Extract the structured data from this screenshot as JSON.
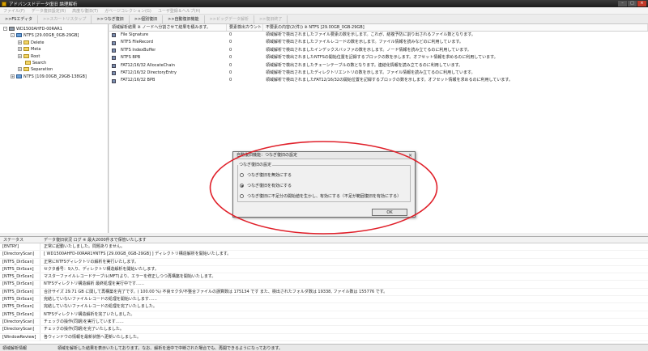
{
  "window": {
    "title": "アドバンスドデータ復旧 論理解析"
  },
  "menu": [
    "ファイル(F)",
    "データ復旧設定(R)",
    "高度な復旧(T)",
    "ガベージコレクション(G)",
    "ユーザ登録＆ヘルプ(H)"
  ],
  "toolbar": [
    {
      "label": ">>FSエディタ",
      "enabled": true
    },
    {
      "label": ">>スカートリスタップ",
      "enabled": false
    },
    {
      "label": ">>つなぎ復旧",
      "enabled": true
    },
    {
      "label": ">>個別復旧",
      "enabled": true
    },
    {
      "label": ">>自動復旧機能",
      "enabled": true
    },
    {
      "label": ">>ビッグデータ解析",
      "enabled": false
    },
    {
      "label": ">>復旧終了",
      "enabled": false
    }
  ],
  "tree": [
    {
      "label": "WD1500AHFD-00RAR1",
      "depth": 0,
      "icon": "disk-icon",
      "expander": "-"
    },
    {
      "label": "NTFS [29.00GB_0GB-29GB]",
      "depth": 1,
      "icon": "volume-icon",
      "expander": "-"
    },
    {
      "label": "Delete",
      "depth": 2,
      "icon": "folder-icon",
      "expander": "+"
    },
    {
      "label": "Meta",
      "depth": 2,
      "icon": "folder-icon",
      "expander": "+"
    },
    {
      "label": "Root",
      "depth": 2,
      "icon": "folder-icon",
      "expander": "+"
    },
    {
      "label": "Search",
      "depth": 2,
      "icon": "folder-icon",
      "expander": ""
    },
    {
      "label": "Separation",
      "depth": 2,
      "icon": "folder-icon",
      "expander": "+"
    },
    {
      "label": "NTFS [109.00GB_29GB-138GB]",
      "depth": 1,
      "icon": "volume-icon",
      "expander": "+"
    }
  ],
  "list": {
    "headers": [
      "領域解析結果 ※ ノードへ分割させて結果を積みます。",
      "要素検出カウント",
      "不要素の内容(2(件)) ※ NTFS [29.00GB_0GB-29GB]"
    ],
    "rows": [
      [
        "File Signature",
        "0",
        "領域解析で検出されましたファイル要素の数を示します。これが、結複予防に割り出されるファイル数となります。"
      ],
      [
        "NTFS FileRecord",
        "0",
        "領域解析で検出されましたファイルレコードの数を示します。ファイル情報を読みなどのに利用しています。"
      ],
      [
        "NTFS IndexBuffer",
        "0",
        "領域解析で検出されましたインデックスバッファの数を示します。ノード情報を読み立てるのに利用しています。"
      ],
      [
        "NTFS BPB",
        "0",
        "領域解析で検出されましたNTFSの開始位置を記録するブロックの数を示します。オフセット情報を求めるのに利用しています。"
      ],
      [
        "FAT12/16/32 AllocateChain",
        "0",
        "領域解析で検出されましたチェーンテーブルの数となります。連結化情報を読み立てるのに利用しています。"
      ],
      [
        "FAT12/16/32 DirectoryEntry",
        "0",
        "領域解析で検出されましたディレクトリエントリの数を示します。ファイル情報を読み立てるのに利用しています。"
      ],
      [
        "FAT12/16/32 BPB",
        "0",
        "領域解析で検出されましたFAT12/16/32の開始位置を記録するブロックの数を示します。オフセット情報を求めるのに利用しています。"
      ]
    ]
  },
  "dialog": {
    "title": "自動復旧機能：つなぎ復旧の設定",
    "close": "×",
    "group_label": "つなぎ復旧の設定",
    "options": [
      {
        "label": "つなぎ復旧を無効にする",
        "selected": false
      },
      {
        "label": "つなぎ復旧を有効にする",
        "selected": true
      },
      {
        "label": "つなぎ復旧に不足分の開始値を生かし、有効にする（不足が範囲復旧を有効にする）",
        "selected": false
      }
    ],
    "ok": "OK"
  },
  "log": {
    "header": [
      "ステータス",
      "データ復旧状況 ログ ※ 最大2000件まで保管いたします"
    ],
    "rows": [
      [
        "[ENTRY]",
        "正常に起動いたしました。問題ありません。"
      ],
      [
        "[DirectoryScan]",
        "[ WD1500AHFD-00RAR1¥NTFS [29.00GB_0GB-29GB] ] ディレクトリ構造解析を開始いたします。"
      ],
      [
        "[NTFS_DirScan]",
        "正常にNTFSディレクトリの解析を実行いたします。"
      ],
      [
        "[NTFS_DirScan]",
        "セクタ番号：9入り、ディレクトリ構造解析を開始いたします。"
      ],
      [
        "[NTFS_DirScan]",
        "マスターファイルレコードテーブル(MFT)より、エラーを修正しつつ再構築を開始いたします。"
      ],
      [
        "[NTFS_DirScan]",
        "NTFSディレクトリ構造解析 最終処理を実行中です……"
      ],
      [
        "[NTFS_DirScan]",
        "合計サイズ 29.71 GB に関して再構築を完了です。( 100.00 %) 不良セクタ/不整合ファイルの誤算数は 175134 です また、検出されたフォルダ数は 19338, ファイル数は 155776 です。"
      ],
      [
        "[NTFS_DirScan]",
        "完結していないファイルレコードの処理を開始いたします……"
      ],
      [
        "[NTFS_DirScan]",
        "完結していないファイルレコードの処理を完了いたしました。"
      ],
      [
        "[NTFS_DirScan]",
        "NTFSディレクトリ構造解析を完了いたしました。"
      ],
      [
        "[DirectoryScan]",
        "チェックの操作(同期)を実行しています……"
      ],
      [
        "[DirectoryScan]",
        "チェックの操作(同期)を完了いたしました。"
      ],
      [
        "[WindowReview]",
        "各ウィンドウの情報を最新状態へ更新いたしました。"
      ]
    ]
  },
  "status": {
    "left": "領域解析情報",
    "right": "領域を解析した結果を表示いたしております。なお、解析を途中で中断された場合でも、再開できるようになっております。"
  },
  "colors": {
    "annotation": "#e0202a",
    "titlebar": "#262626"
  }
}
